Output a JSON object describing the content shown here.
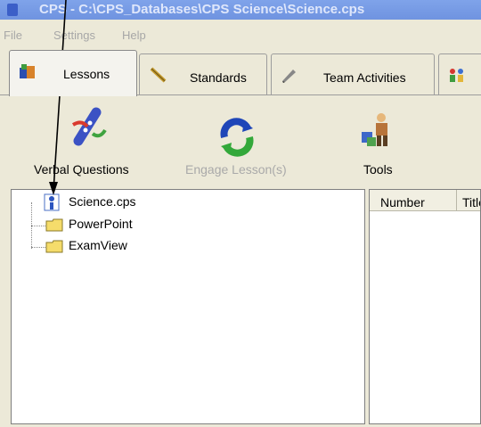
{
  "window": {
    "title": "CPS - C:\\CPS_Databases\\CPS Science\\Science.cps"
  },
  "menu": {
    "file": "File",
    "settings": "Settings",
    "help": "Help"
  },
  "tabs": [
    {
      "label": "Lessons",
      "icon": "lessons-icon",
      "active": true
    },
    {
      "label": "Standards",
      "icon": "ruler-icon"
    },
    {
      "label": "Team Activities",
      "icon": "pen-icon"
    },
    {
      "label": "",
      "icon": "people-icon"
    }
  ],
  "toolbar": {
    "verbal_questions": "Verbal Questions",
    "engage_lessons": "Engage Lesson(s)",
    "tools": "Tools"
  },
  "tree": {
    "items": [
      {
        "label": "Science.cps",
        "icon": "database-icon"
      },
      {
        "label": "PowerPoint",
        "icon": "folder-icon"
      },
      {
        "label": "ExamView",
        "icon": "folder-icon"
      }
    ]
  },
  "list": {
    "columns": [
      "Number",
      "Title"
    ]
  },
  "colors": {
    "title_bar": "#7fa3ea",
    "selection": "#316ac5",
    "folder": "#f5dc6b"
  }
}
